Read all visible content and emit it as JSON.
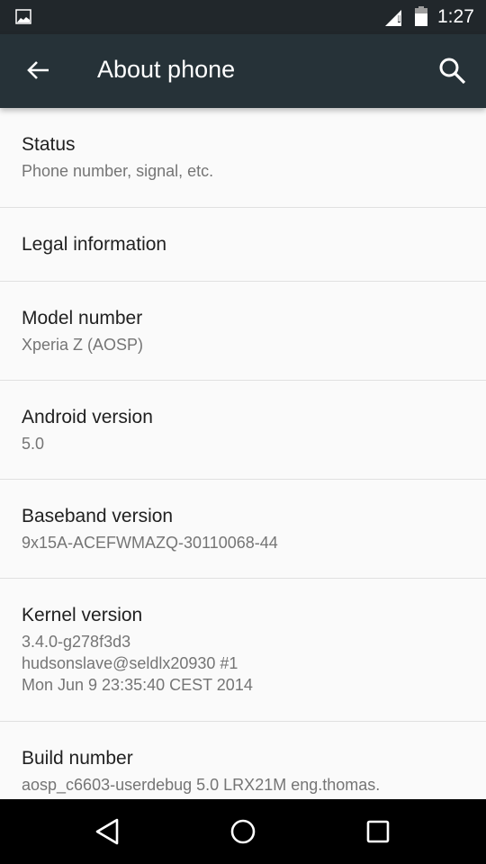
{
  "status_bar": {
    "time": "1:27",
    "icons": [
      "image-notification-icon",
      "signal-no-data-icon",
      "battery-icon"
    ]
  },
  "toolbar": {
    "title": "About phone",
    "back_icon": "arrow-back-icon",
    "search_icon": "search-icon"
  },
  "items": [
    {
      "title": "Status",
      "summary": "Phone number, signal, etc."
    },
    {
      "title": "Legal information",
      "summary": ""
    },
    {
      "title": "Model number",
      "summary": "Xperia Z (AOSP)"
    },
    {
      "title": "Android version",
      "summary": "5.0"
    },
    {
      "title": "Baseband version",
      "summary": "9x15A-ACEFWMAZQ-30110068-44"
    },
    {
      "title": "Kernel version",
      "summary": "3.4.0-g278f3d3\nhudsonslave@seldlx20930 #1\nMon Jun 9 23:35:40 CEST 2014"
    },
    {
      "title": "Build number",
      "summary": "aosp_c6603-userdebug 5.0 LRX21M eng.thomas."
    }
  ],
  "nav_bar": {
    "buttons": [
      "back-nav-icon",
      "home-nav-icon",
      "recents-nav-icon"
    ]
  }
}
